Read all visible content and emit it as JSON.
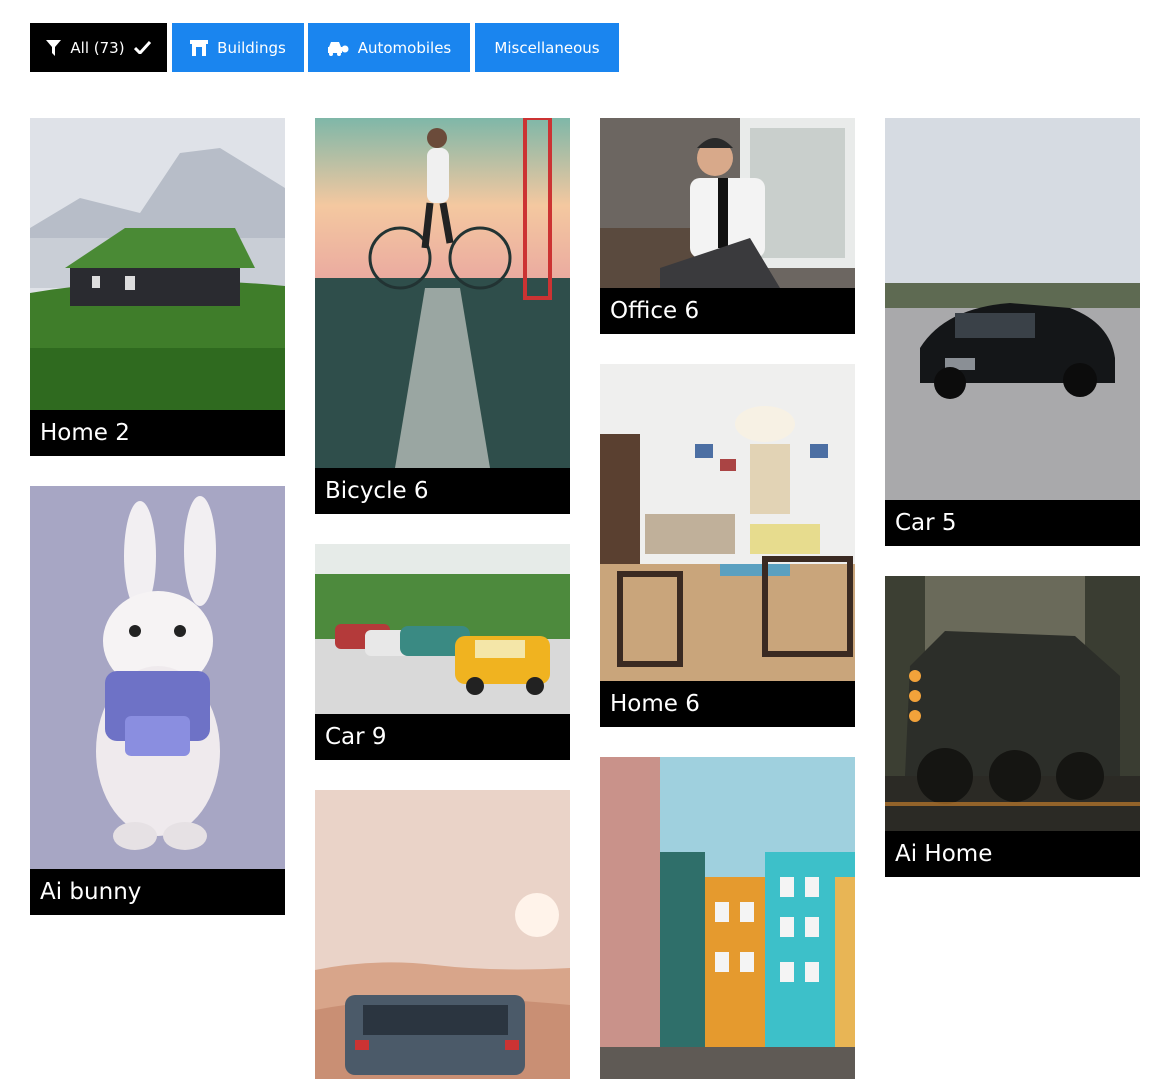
{
  "filters": {
    "all": "All (73)",
    "buildings": "Buildings",
    "automobiles": "Automobiles",
    "miscellaneous": "Miscellaneous"
  },
  "gallery": {
    "home2": "Home 2",
    "bicycle6": "Bicycle 6",
    "office6": "Office 6",
    "car5": "Car 5",
    "aibunny": "Ai bunny",
    "car9": "Car 9",
    "home6": "Home 6",
    "aihome": "Ai Home"
  },
  "colors": {
    "accent": "#1a85ef",
    "active": "#000000",
    "caption_bg": "#000000"
  }
}
